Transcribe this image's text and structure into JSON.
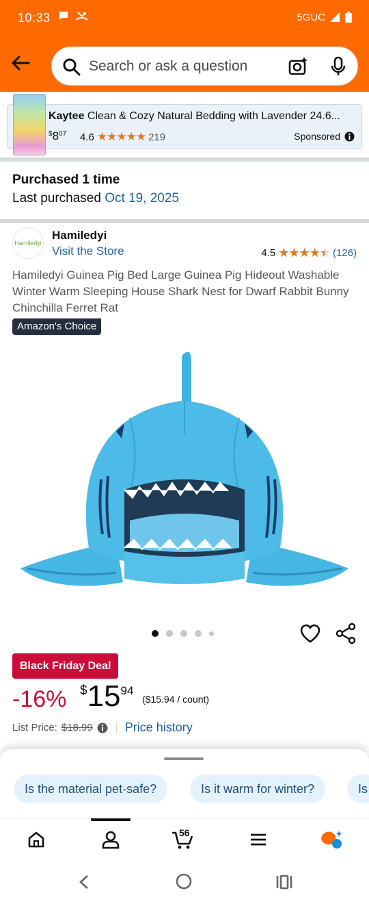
{
  "status_bar": {
    "time": "10:33",
    "network": "5GUC"
  },
  "search": {
    "placeholder": "Search or ask a question"
  },
  "ad": {
    "brand": "Kaytee",
    "title": " Clean & Cozy Natural Bedding with Lavender 24.6...",
    "price_dollars": "8",
    "price_cents": "07",
    "price_symbol": "$",
    "rating": "4.6",
    "rating_count": "219",
    "sponsored_label": "Sponsored"
  },
  "purchase_history": {
    "title": "Purchased 1 time",
    "last_label": "Last purchased ",
    "last_date": "Oct 19, 2025"
  },
  "store": {
    "logo_text": "Hamiledyi",
    "name": "Hamiledyi",
    "visit_label": "Visit the Store",
    "rating": "4.5",
    "rating_fraction": 0.9,
    "review_count": "(126)"
  },
  "product": {
    "title": "Hamiledyi Guinea Pig Bed Large Guinea Pig Hideout Washable Winter Warm Sleeping House Shark Nest for Dwarf Rabbit Bunny Chinchilla Ferret Rat",
    "badge": "Amazon's Choice",
    "image_count": 5,
    "active_image": 1
  },
  "pricing": {
    "deal_badge": "Black Friday Deal",
    "discount": "-16%",
    "symbol": "$",
    "whole": "15",
    "fraction": "94",
    "unit_price": "($15.94 / count)",
    "list_price_label": "List Price:",
    "list_price_value": "$18.99",
    "price_history_label": "Price history"
  },
  "suggestions": [
    "Is the material pet-safe?",
    "Is it warm for winter?",
    "Is"
  ],
  "bottom_nav": {
    "cart_count": "56"
  },
  "colors": {
    "header": "#ff6a00",
    "link": "#2162a1",
    "deal": "#cc0c39",
    "star": "#de7921"
  }
}
